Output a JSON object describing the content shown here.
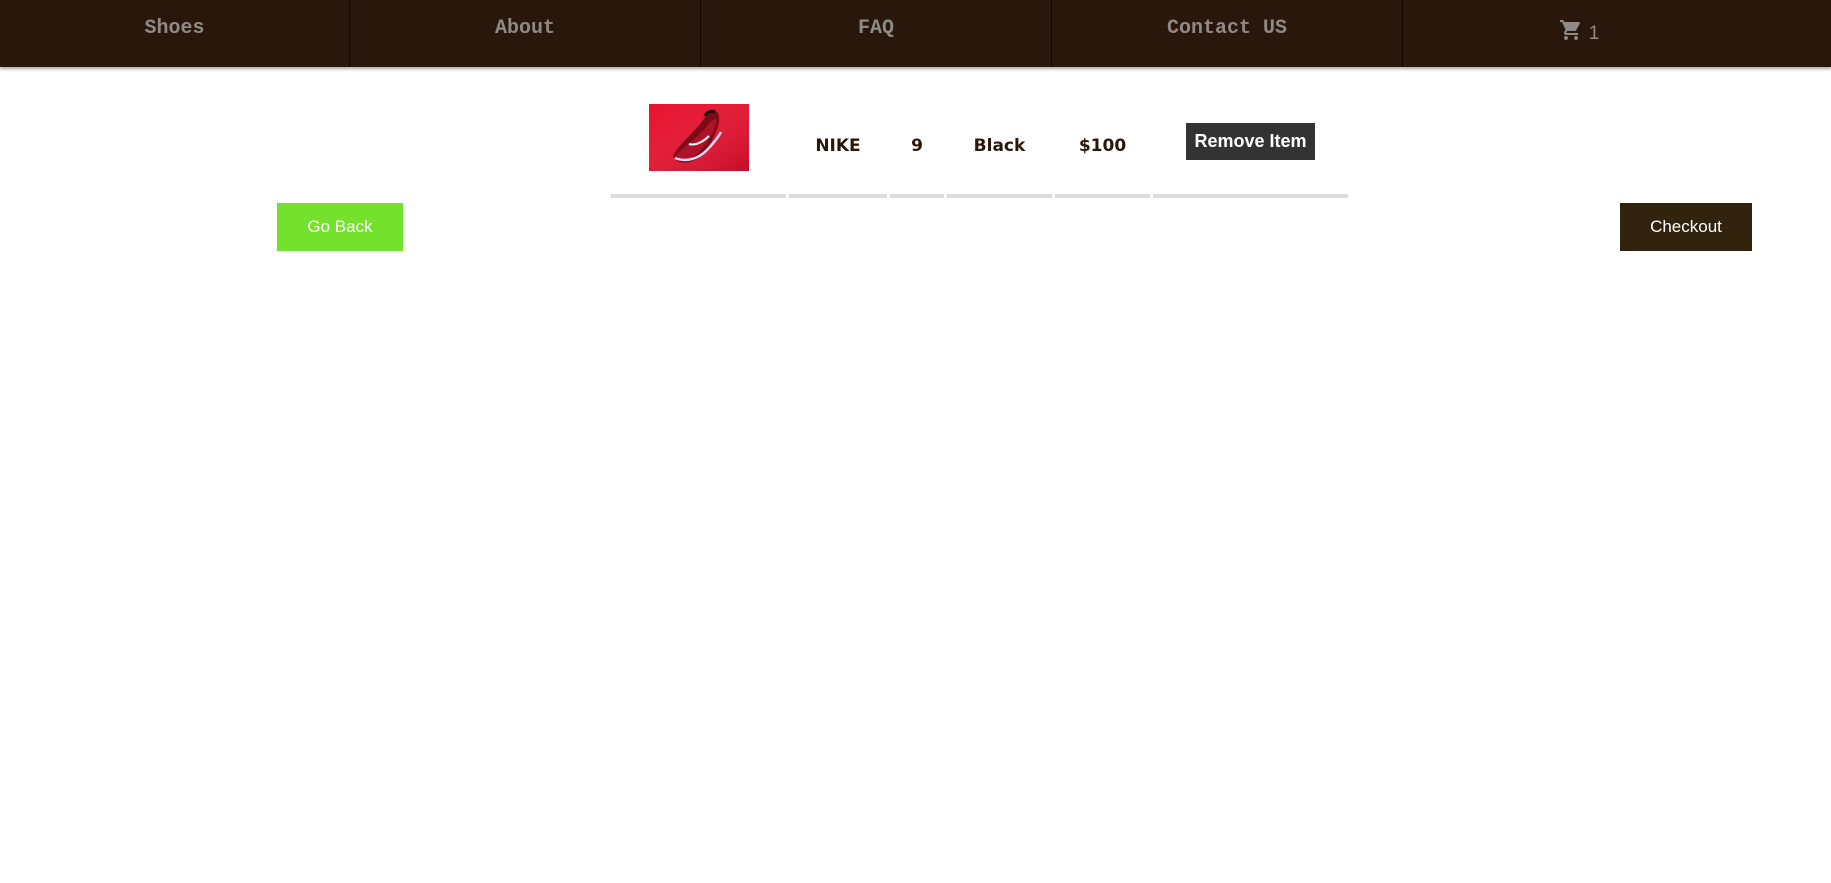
{
  "nav": {
    "items": [
      {
        "label": "Shoes"
      },
      {
        "label": "About"
      },
      {
        "label": "FAQ"
      },
      {
        "label": "Contact US"
      }
    ],
    "cart": {
      "icon": "shopping-cart-icon",
      "count": "1"
    }
  },
  "cart_items": [
    {
      "image": "red-nike-shoe-image",
      "brand": "NIKE",
      "size": "9",
      "color": "Black",
      "price": "$100",
      "remove_label": "Remove Item"
    }
  ],
  "actions": {
    "go_back_label": "Go Back",
    "checkout_label": "Checkout"
  },
  "colors": {
    "nav_bg": "#2a170b",
    "nav_text": "#8f8a86",
    "go_back_bg": "#74e22c",
    "checkout_bg": "#32230f",
    "remove_bg": "#333333",
    "text_primary": "#2a170b"
  }
}
